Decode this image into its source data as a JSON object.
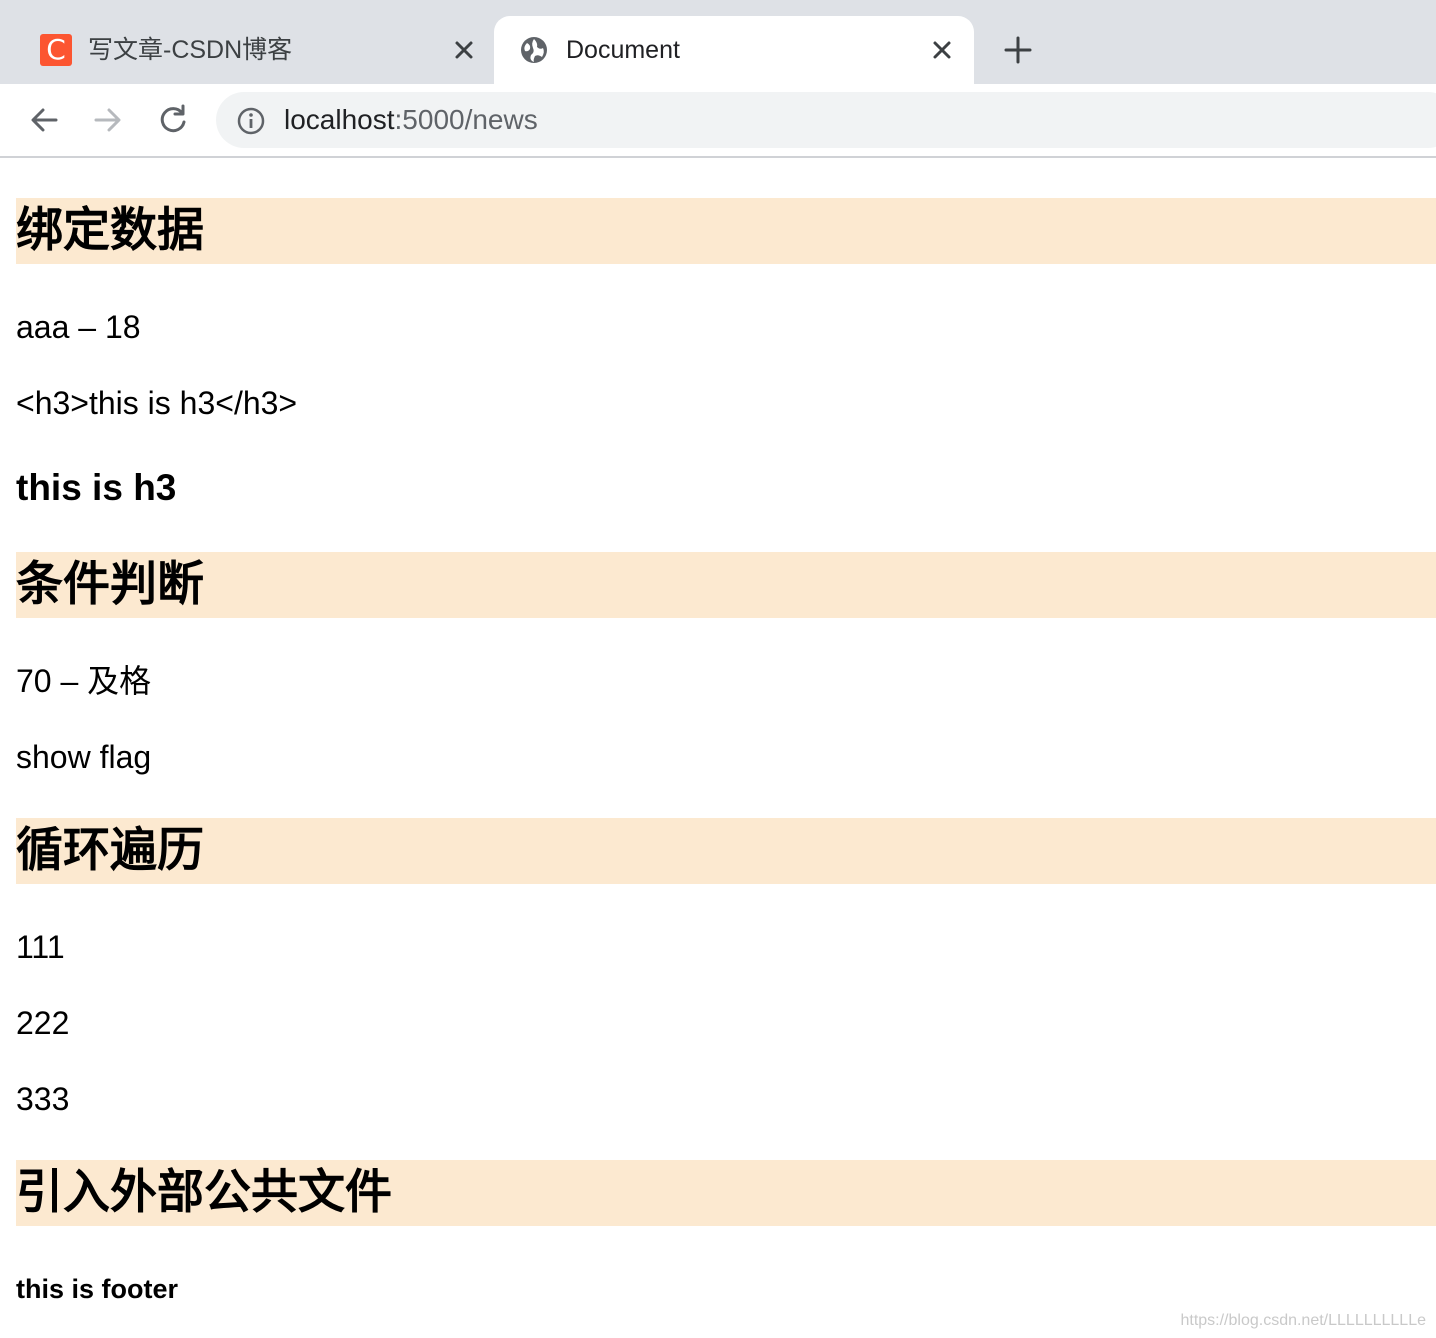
{
  "browser": {
    "tabs": [
      {
        "title": "写文章-CSDN博客",
        "favicon_letter": "C",
        "active": false
      },
      {
        "title": "Document",
        "active": true
      }
    ],
    "address_bar": {
      "host": "localhost",
      "path": ":5000/news"
    }
  },
  "page": {
    "section_bind": {
      "title": "绑定数据"
    },
    "bind_line1": "aaa – 18",
    "bind_line2": "<h3>this is h3</h3>",
    "bind_h3": "this is h3",
    "section_if": {
      "title": "条件判断"
    },
    "if_line1": "70 – 及格",
    "if_line2": "show flag",
    "section_loop": {
      "title": "循环遍历"
    },
    "loop_items": [
      "111",
      "222",
      "333"
    ],
    "section_include": {
      "title": "引入外部公共文件"
    },
    "footer_text": "this is footer"
  },
  "watermark": "https://blog.csdn.net/LLLLLLLLLLe",
  "colors": {
    "section_background": "#fce9d0",
    "tabstrip": "#dee1e6",
    "csdn_brand": "#fc5531"
  }
}
